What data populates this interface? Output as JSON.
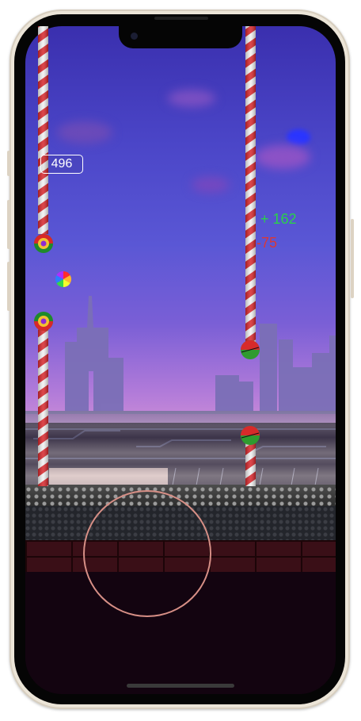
{
  "hud": {
    "score": "496",
    "gain_popup": "+ 162",
    "loss_popup": "-75"
  },
  "colors": {
    "pole_red": "#d7262b",
    "pole_white": "#f2f2f2",
    "gain": "#2bd14a",
    "loss": "#d93838",
    "joystick_ring": "#d78f86"
  },
  "icons": {
    "color_wheel": "rainbow-wheel-icon",
    "candy_ball": "striped-candy-ball",
    "watermelon_ball": "watermelon-ball"
  }
}
